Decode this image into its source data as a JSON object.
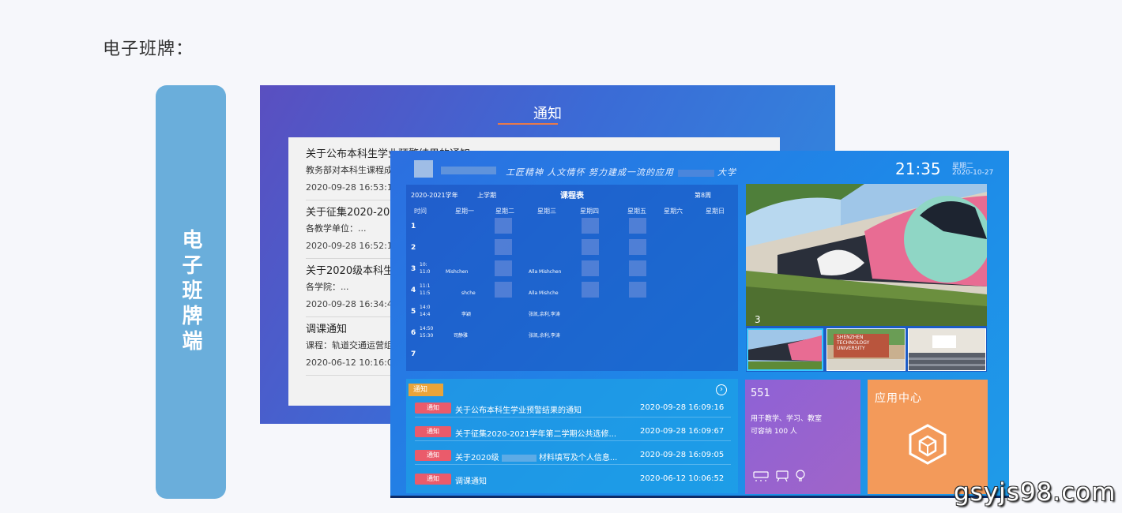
{
  "page": {
    "heading": "电子班牌："
  },
  "side_label": "电子班牌端",
  "back_screen": {
    "title": "通知",
    "items": [
      {
        "title": "关于公布本科生学业预警结果的通知",
        "subtitle": "教务部对本科生课程成",
        "date": "2020-09-28 16:53:19"
      },
      {
        "title": "关于征集2020-202",
        "subtitle": "各教学单位：...",
        "date": "2020-09-28 16:52:18"
      },
      {
        "title": "关于2020级本科生",
        "subtitle": "各学院：...",
        "date": "2020-09-28 16:34:43"
      },
      {
        "title": "调课通知",
        "subtitle": "课程：轨道交通运营组",
        "date": "2020-06-12 10:16:06"
      }
    ]
  },
  "front_screen": {
    "slogan": "工匠精神 人文情怀 努力建成一流的应用",
    "slogan_suffix": "大学",
    "clock": "21:35",
    "weekday": "星期二",
    "date": "2020-10-27",
    "timetable": {
      "academic_year": "2020-2021学年",
      "term": "上学期",
      "title": "课程表",
      "week": "第8周",
      "headers": [
        "时间",
        "星期一",
        "星期二",
        "星期三",
        "星期四",
        "星期五",
        "星期六",
        "星期日"
      ],
      "periods": [
        {
          "num": "1",
          "time": ""
        },
        {
          "num": "2",
          "time": ""
        },
        {
          "num": "3",
          "time": "10:",
          "time2": "11:0"
        },
        {
          "num": "4",
          "time": "11:1",
          "time2": "11:5"
        },
        {
          "num": "5",
          "time": "14:0",
          "time2": "14:4"
        },
        {
          "num": "6",
          "time": "14:50",
          "time2": "15:30"
        },
        {
          "num": "7",
          "time": ""
        }
      ],
      "cells": {
        "p3_mon": "Mishchen",
        "p3_wed": "Alla Mishchen",
        "p4_mon": "shche",
        "p4_wed": "Alla Mishche",
        "p5_mon": "李颖",
        "p5_wed": "张凯,余利,李涛",
        "p6_mon": "司静雅",
        "p6_wed": "张凯,余利,李涛"
      }
    },
    "photos": {
      "counter": "3",
      "thumb2_text": "SHENZHEN TECHNOLOGY UNIVERSITY"
    },
    "notices": {
      "tab": "通知",
      "arrow": "›",
      "badge": "通知",
      "items": [
        {
          "title": "关于公布本科生学业预警结果的通知",
          "date": "2020-09-28 16:09:16"
        },
        {
          "title": "关于征集2020-2021学年第二学期公共选修...",
          "date": "2020-09-28 16:09:67"
        },
        {
          "title": "关于2020级",
          "title_suffix": "材料填写及个人信息...",
          "date": "2020-09-28 16:09:05"
        },
        {
          "title": "调课通知",
          "date": "2020-06-12 10:06:52"
        }
      ]
    },
    "room": {
      "number": "551",
      "desc_line1": "用于教学、学习、教室",
      "desc_line2": "可容纳 100 人"
    },
    "app_center": {
      "label": "应用中心"
    }
  },
  "watermark": "gsyjs98.com",
  "colors": {
    "accent_orange": "#e7794a",
    "badge_red": "#ea5b6b",
    "app_tile": "#f39a5a",
    "room_tile": "#9a63cf",
    "side_pill": "#6aaedb"
  }
}
